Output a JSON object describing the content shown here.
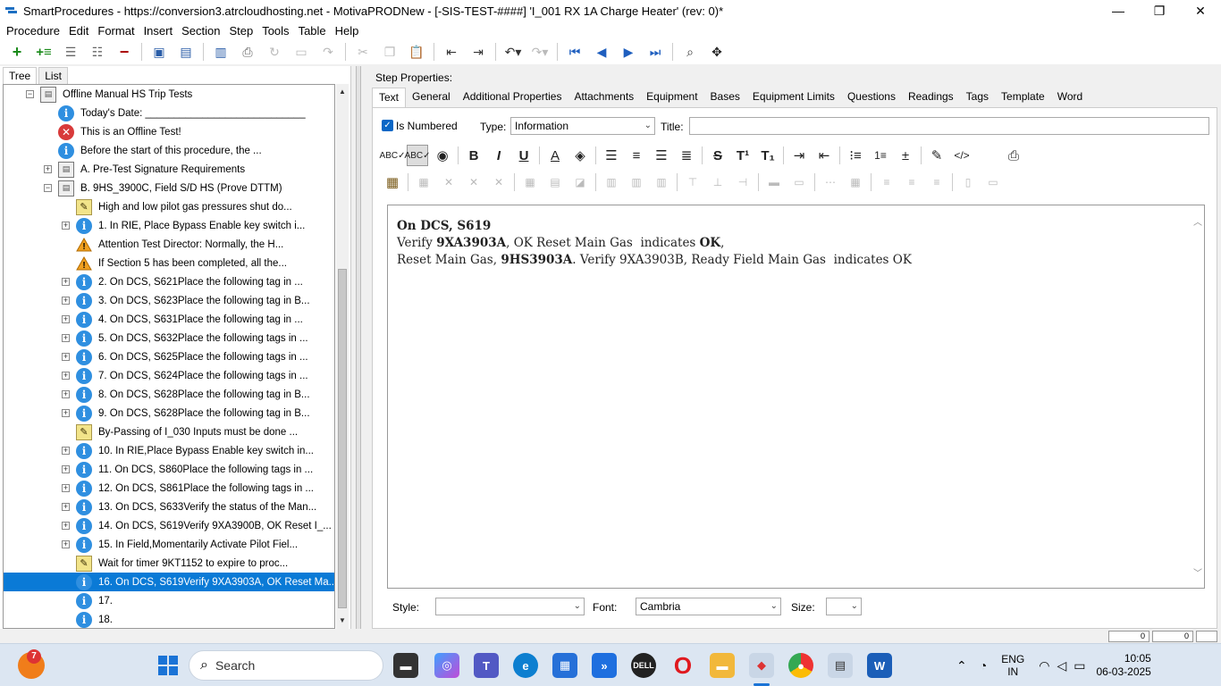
{
  "titlebar": {
    "title": "SmartProcedures - https://conversion3.atrcloudhosting.net - MotivaPRODNew - [-SIS-TEST-####] 'I_001 RX 1A Charge Heater' (rev: 0)*",
    "minimize": "—",
    "restore": "❐",
    "close": "✕"
  },
  "menu": [
    "Procedure",
    "Edit",
    "Format",
    "Insert",
    "Section",
    "Step",
    "Tools",
    "Table",
    "Help"
  ],
  "left_tabs": [
    "Tree",
    "List"
  ],
  "tree": [
    {
      "label": "Offline Manual HS Trip Tests",
      "icon": "folder",
      "exp": "−",
      "level": 0
    },
    {
      "label": "Today's Date: ____________________________",
      "icon": "info",
      "exp": "",
      "level": 1
    },
    {
      "label": "This is an Offline Test!",
      "icon": "error",
      "exp": "",
      "level": 1
    },
    {
      "label": "Before the start of this procedure, the ...",
      "icon": "info",
      "exp": "",
      "level": 1
    },
    {
      "label": "A. Pre-Test Signature Requirements",
      "icon": "folder",
      "exp": "+",
      "level": 1
    },
    {
      "label": "B. 9HS_3900C, Field S/D HS (Prove DTTM)",
      "icon": "folder",
      "exp": "−",
      "level": 1
    },
    {
      "label": "High and low pilot gas pressures shut do...",
      "icon": "note",
      "exp": "",
      "level": 2
    },
    {
      "label": "1. In RIE, Place Bypass Enable key switch i...",
      "icon": "info",
      "exp": "+",
      "level": 2
    },
    {
      "label": "Attention Test Director: Normally, the H...",
      "icon": "warn",
      "exp": "",
      "level": 2
    },
    {
      "label": "If Section 5 has been completed, all the...",
      "icon": "warn",
      "exp": "",
      "level": 2
    },
    {
      "label": "2. On DCS, S621Place the following tag in ...",
      "icon": "info",
      "exp": "+",
      "level": 2
    },
    {
      "label": "3. On DCS, S623Place the following tag in B...",
      "icon": "info",
      "exp": "+",
      "level": 2
    },
    {
      "label": "4. On DCS, S631Place the following tag in ...",
      "icon": "info",
      "exp": "+",
      "level": 2
    },
    {
      "label": "5. On DCS, S632Place the following tags in ...",
      "icon": "info",
      "exp": "+",
      "level": 2
    },
    {
      "label": "6. On DCS, S625Place the following tags in ...",
      "icon": "info",
      "exp": "+",
      "level": 2
    },
    {
      "label": "7. On DCS, S624Place the following tags in ...",
      "icon": "info",
      "exp": "+",
      "level": 2
    },
    {
      "label": "8. On DCS, S628Place the following tag in B...",
      "icon": "info",
      "exp": "+",
      "level": 2
    },
    {
      "label": "9. On DCS, S628Place the following tag in B...",
      "icon": "info",
      "exp": "+",
      "level": 2
    },
    {
      "label": "By-Passing of I_030 Inputs must be done ...",
      "icon": "note",
      "exp": "",
      "level": 2
    },
    {
      "label": "10. In RIE,Place Bypass Enable key switch in...",
      "icon": "info",
      "exp": "+",
      "level": 2
    },
    {
      "label": "11. On DCS, S860Place the following tags in ...",
      "icon": "info",
      "exp": "+",
      "level": 2
    },
    {
      "label": "12. On DCS, S861Place the following tags in ...",
      "icon": "info",
      "exp": "+",
      "level": 2
    },
    {
      "label": "13. On DCS, S633Verify the status of the Man...",
      "icon": "info",
      "exp": "+",
      "level": 2
    },
    {
      "label": "14. On DCS, S619Verify 9XA3900B, OK Reset I_...",
      "icon": "info",
      "exp": "+",
      "level": 2
    },
    {
      "label": "15. In Field,Momentarily Activate Pilot Fiel...",
      "icon": "info",
      "exp": "+",
      "level": 2
    },
    {
      "label": "Wait for timer 9KT1152 to expire to proc...",
      "icon": "note",
      "exp": "",
      "level": 2
    },
    {
      "label": "16. On DCS, S619Verify 9XA3903A, OK Reset Ma...",
      "icon": "info",
      "exp": "",
      "level": 2,
      "selected": true
    },
    {
      "label": "17.",
      "icon": "info",
      "exp": "",
      "level": 2
    },
    {
      "label": "18.",
      "icon": "info",
      "exp": "",
      "level": 2
    }
  ],
  "step_properties_label": "Step Properties:",
  "prop_tabs": [
    "Text",
    "General",
    "Additional Properties",
    "Attachments",
    "Equipment",
    "Bases",
    "Equipment Limits",
    "Questions",
    "Readings",
    "Tags",
    "Template",
    "Word"
  ],
  "form": {
    "is_numbered_label": "Is Numbered",
    "type_label": "Type:",
    "type_value": "Information",
    "title_label": "Title:",
    "title_value": ""
  },
  "editor": {
    "line1": {
      "bold": "On DCS, S619"
    },
    "line2": {
      "a": "Verify ",
      "b": "9XA3903A",
      "c": ", OK Reset Main Gas  indicates ",
      "d": "OK",
      "e": ","
    },
    "line3": {
      "a": "Reset Main Gas, ",
      "b": "9HS3903A",
      "c": ". Verify 9XA3903B, Ready Field Main Gas  indicates OK"
    }
  },
  "style_row": {
    "style_label": "Style:",
    "style_value": "",
    "font_label": "Font:",
    "font_value": "Cambria",
    "size_label": "Size:",
    "size_value": ""
  },
  "status_boxes": [
    "0",
    "0"
  ],
  "taskbar": {
    "search_placeholder": "Search",
    "notification_count": "7",
    "lang_top": "ENG",
    "lang_bottom": "IN",
    "time": "10:05",
    "date": "06-03-2025"
  }
}
